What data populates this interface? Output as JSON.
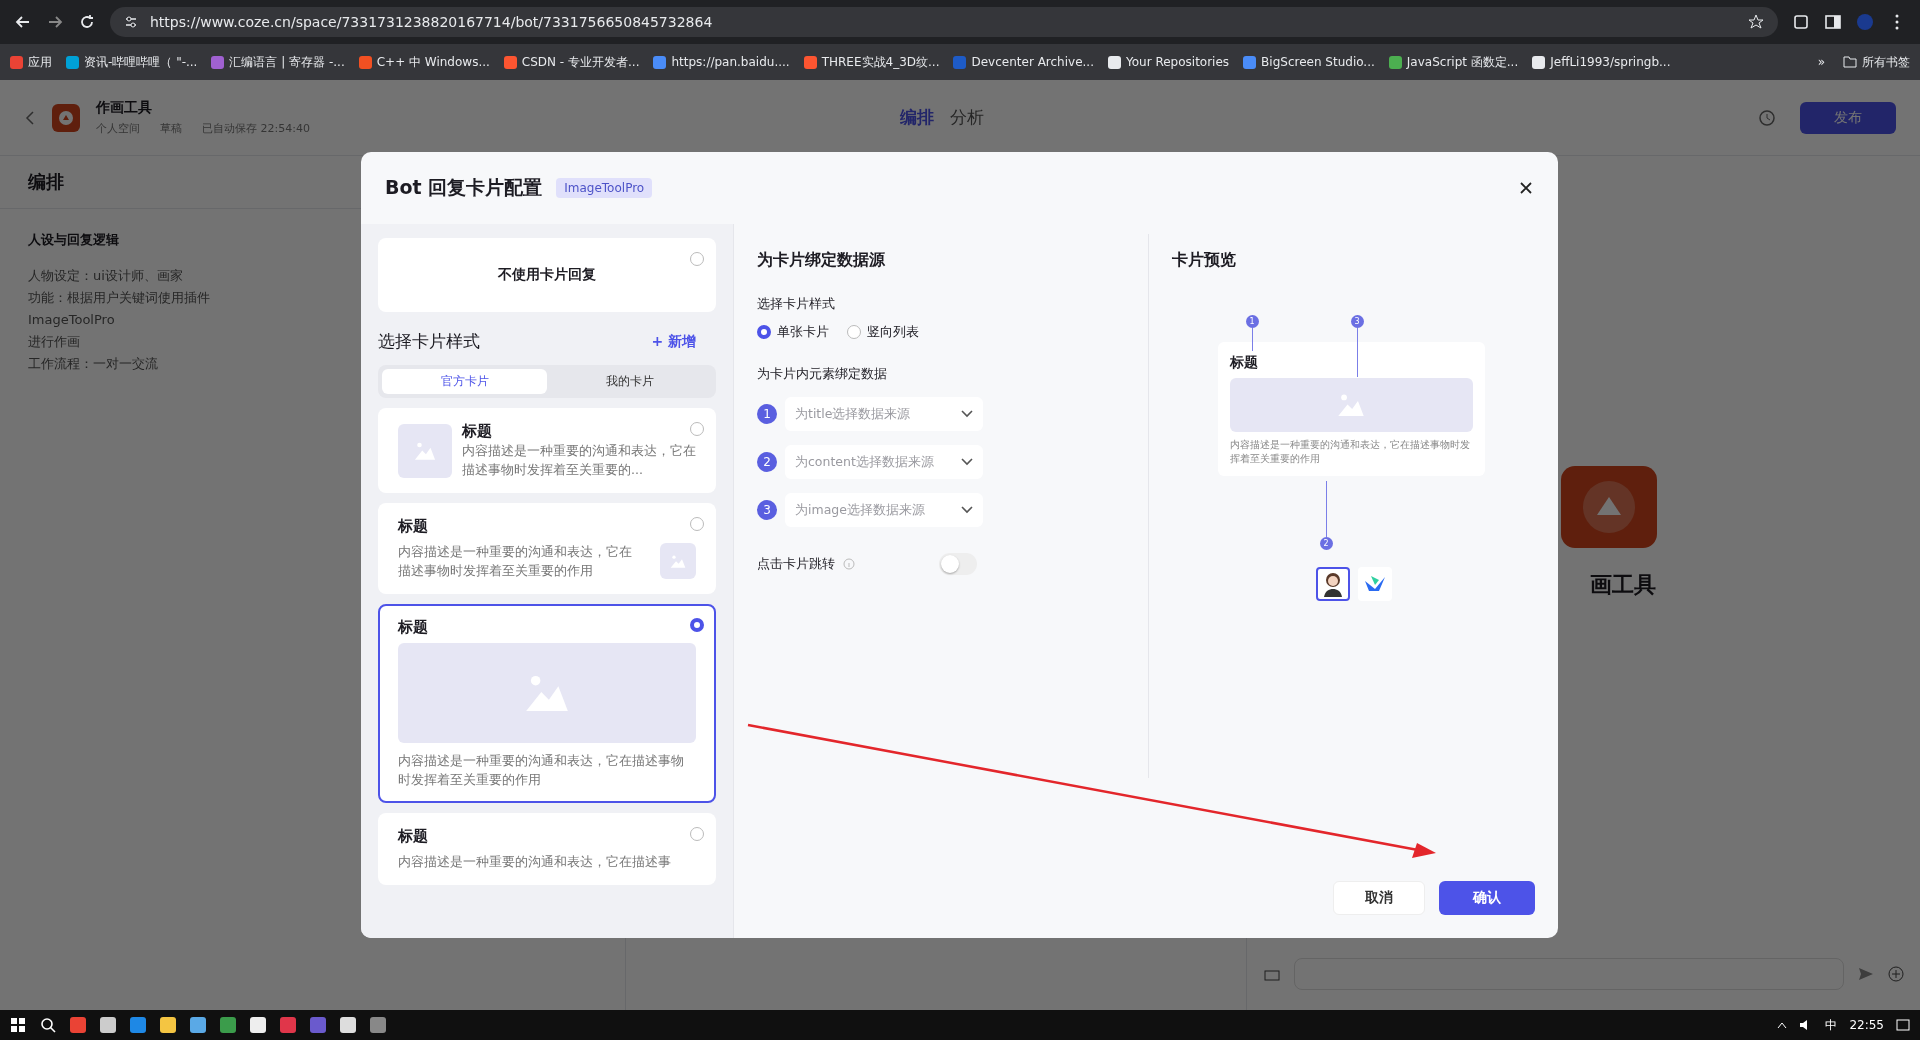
{
  "browser": {
    "url": "https://www.coze.cn/space/7331731238820167714/bot/7331756650845732864",
    "bookmarks": [
      {
        "label": "应用",
        "color": "#ea4335"
      },
      {
        "label": "资讯-哔哩哔哩（ \"-...",
        "color": "#00a1d6"
      },
      {
        "label": "汇编语言 | 寄存器 -...",
        "color": "#a061d1"
      },
      {
        "label": "C++ 中 Windows...",
        "color": "#f25022"
      },
      {
        "label": "CSDN - 专业开发者...",
        "color": "#fc5531"
      },
      {
        "label": "https://pan.baidu....",
        "color": "#4a8cf7"
      },
      {
        "label": "THREE实战4_3D纹...",
        "color": "#fc5531"
      },
      {
        "label": "Devcenter Archive...",
        "color": "#1e5bc6"
      },
      {
        "label": "Your Repositories",
        "color": "#e8eaed"
      },
      {
        "label": "BigScreen Studio...",
        "color": "#4a8cf7"
      },
      {
        "label": "JavaScript 函数定...",
        "color": "#4caf50"
      },
      {
        "label": "JeffLi1993/springb...",
        "color": "#e8eaed"
      }
    ],
    "more": "»",
    "all_bookmarks": "所有书签"
  },
  "header": {
    "bot_name": "作画工具",
    "workspace": "个人空间",
    "status": "草稿",
    "autosave": "已自动保存 22:54:40",
    "tabs": [
      {
        "label": "编排",
        "selected": true
      },
      {
        "label": "分析",
        "selected": false
      }
    ],
    "publish": "发布"
  },
  "sidebar": {
    "title": "编排",
    "section": "人设与回复逻辑",
    "prompt_lines": [
      "人物设定：ui设计师、画家",
      "功能：根据用户关键词使用插件",
      "ImageToolPro",
      "进行作画",
      "工作流程：一对一交流"
    ]
  },
  "canvas": {
    "bot_label": "画工具"
  },
  "modal": {
    "title": "Bot 回复卡片配置",
    "plugin_tag": "ImageToolPro",
    "no_card": {
      "label": "不使用卡片回复",
      "selected": false
    },
    "styles_heading": "选择卡片样式",
    "add_icon": "+",
    "add_label": "新增",
    "card_tabs": [
      {
        "label": "官方卡片",
        "selected": true
      },
      {
        "label": "我的卡片",
        "selected": false
      }
    ],
    "cards": [
      {
        "kind": "thumb_left",
        "title": "标题",
        "description": "内容描述是一种重要的沟通和表达，它在描述事物时发挥着至关重要的...",
        "selected": false
      },
      {
        "kind": "thumb_right",
        "title": "标题",
        "description": "内容描述是一种重要的沟通和表达，它在描述事物时发挥着至关重要的作用",
        "selected": false
      },
      {
        "kind": "image_large",
        "title": "标题",
        "description": "内容描述是一种重要的沟通和表达，它在描述事物时发挥着至关重要的作用",
        "selected": true
      },
      {
        "kind": "text",
        "title": "标题",
        "description": "内容描述是一种重要的沟通和表达，它在描述事",
        "selected": false
      }
    ],
    "binding": {
      "heading": "为卡片绑定数据源",
      "style_label": "选择卡片样式",
      "layouts": [
        {
          "label": "单张卡片",
          "selected": true
        },
        {
          "label": "竖向列表",
          "selected": false
        }
      ],
      "elements_label": "为卡片内元素绑定数据",
      "fields": [
        {
          "number": "1",
          "placeholder": "为title选择数据来源"
        },
        {
          "number": "2",
          "placeholder": "为content选择数据来源"
        },
        {
          "number": "3",
          "placeholder": "为image选择数据来源"
        }
      ],
      "jump_label": "点击卡片跳转",
      "jump_on": false
    },
    "preview": {
      "heading": "卡片预览",
      "card_title": "标题",
      "card_description": "内容描述是一种重要的沟通和表达，它在描述事物时发挥着至关重要的作用",
      "callouts": [
        "1",
        "3",
        "2"
      ],
      "avatars": [
        {
          "kind": "person",
          "selected": true
        },
        {
          "kind": "logo",
          "selected": false
        }
      ]
    },
    "buttons": {
      "cancel": "取消",
      "confirm": "确认"
    }
  },
  "taskbar": {
    "ime": "中",
    "clock": "22:55"
  }
}
